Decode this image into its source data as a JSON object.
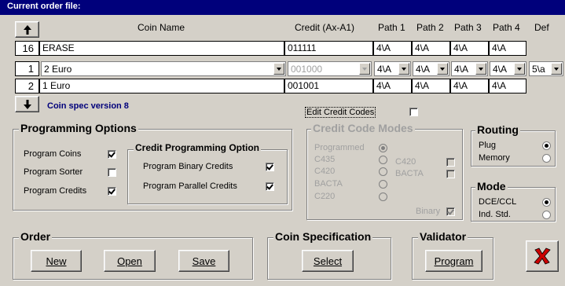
{
  "title": "Current order file:",
  "columns": {
    "coin_name": "Coin Name",
    "credit": "Credit (Ax-A1)",
    "path1": "Path 1",
    "path2": "Path 2",
    "path3": "Path 3",
    "path4": "Path 4",
    "def": "Def"
  },
  "rows": [
    {
      "index": "16",
      "name": "ERASE",
      "credit": "011111",
      "p1": "4\\A",
      "p2": "4\\A",
      "p3": "4\\A",
      "p4": "4\\A"
    },
    {
      "index": "1",
      "name": "2 Euro",
      "credit": "001000",
      "p1": "4\\A",
      "p2": "4\\A",
      "p3": "4\\A",
      "p4": "4\\A",
      "def": "5\\a"
    },
    {
      "index": "2",
      "name": "1 Euro",
      "credit": "001001",
      "p1": "4\\A",
      "p2": "4\\A",
      "p3": "4\\A",
      "p4": "4\\A"
    }
  ],
  "coin_spec_version": "Coin spec version  8",
  "edit_credit_codes": "Edit Credit Codes",
  "programming_options": {
    "title": "Programming Options",
    "program_coins": "Program Coins",
    "program_sorter": "Program Sorter",
    "program_credits": "Program Credits"
  },
  "credit_programming": {
    "title": "Credit Programming Option",
    "binary": "Program Binary Credits",
    "parallel": "Program Parallel Credits"
  },
  "credit_code_modes": {
    "title": "Credit Code Modes",
    "programmed": "Programmed",
    "c435": "C435",
    "c420": "C420",
    "bacta": "BACTA",
    "c220": "C220",
    "c420b": "C420",
    "bactab": "BACTA",
    "binary": "Binary"
  },
  "routing": {
    "title": "Routing",
    "plug": "Plug",
    "memory": "Memory"
  },
  "mode": {
    "title": "Mode",
    "dce": "DCE/CCL",
    "ind": "Ind. Std."
  },
  "order": {
    "title": "Order",
    "new": "New",
    "open": "Open",
    "save": "Save"
  },
  "coin_spec": {
    "title": "Coin Specification",
    "select": "Select"
  },
  "validator": {
    "title": "Validator",
    "program": "Program"
  },
  "colors": {
    "titlebar": "#00007b",
    "version_text": "#00007b",
    "close_x": "#cc0000"
  }
}
